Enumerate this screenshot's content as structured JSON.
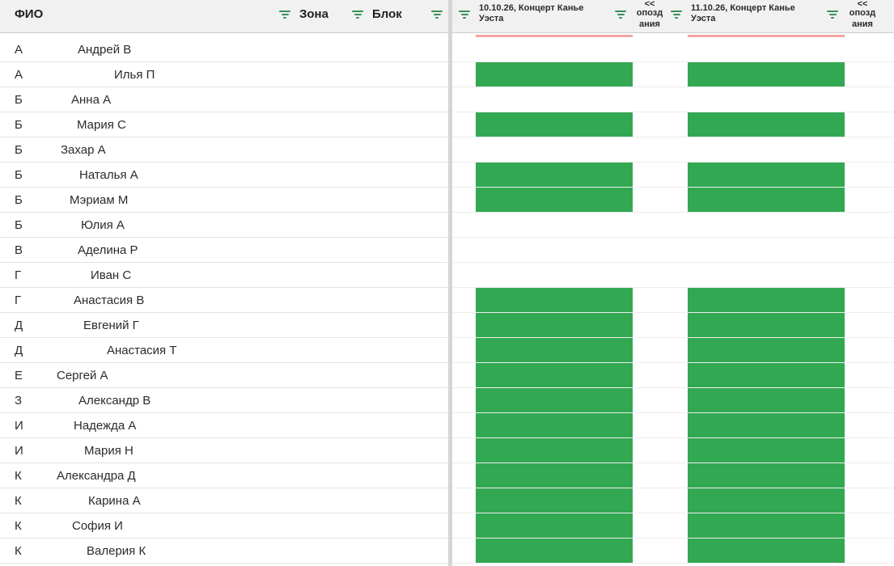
{
  "header": {
    "fio": "ФИО",
    "zona": "Зона",
    "blok": "Блок",
    "event1_line1": "10.10.26, Концерт Канье",
    "event1_line2": "Уэста",
    "late1_line1": "<<",
    "late1_line2": "опозд",
    "late1_line3": "ания",
    "event2_line1": "11.10.26, Концерт Канье",
    "event2_line2": "Уэста",
    "late2_line1": "<<",
    "late2_line2": "опозд",
    "late2_line3": "ания"
  },
  "colors": {
    "attended": "#33a853",
    "filter_icon": "#3a8f55",
    "header_bg": "#f1f1f1"
  },
  "rows": [
    {
      "zone": "А",
      "name": "Андрей В",
      "event1": false,
      "event2": false
    },
    {
      "zone": "А",
      "name": "Илья П",
      "event1": true,
      "event2": true
    },
    {
      "zone": "Б",
      "name": "Анна А",
      "event1": false,
      "event2": false
    },
    {
      "zone": "Б",
      "name": "Мария С",
      "event1": true,
      "event2": true
    },
    {
      "zone": "Б",
      "name": "Захар А",
      "event1": false,
      "event2": false
    },
    {
      "zone": "Б",
      "name": "Наталья А",
      "event1": true,
      "event2": true
    },
    {
      "zone": "Б",
      "name": "Мэриам М",
      "event1": true,
      "event2": true
    },
    {
      "zone": "Б",
      "name": "Юлия А",
      "event1": false,
      "event2": false
    },
    {
      "zone": "В",
      "name": "Аделина Р",
      "event1": false,
      "event2": false
    },
    {
      "zone": "Г",
      "name": "Иван С",
      "event1": false,
      "event2": false
    },
    {
      "zone": "Г",
      "name": "Анастасия В",
      "event1": true,
      "event2": true
    },
    {
      "zone": "Д",
      "name": "Евгений Г",
      "event1": true,
      "event2": true
    },
    {
      "zone": "Д",
      "name": "Анастасия Т",
      "event1": true,
      "event2": true
    },
    {
      "zone": "Е",
      "name": "Сергей А",
      "event1": true,
      "event2": true
    },
    {
      "zone": "З",
      "name": "Александр В",
      "event1": true,
      "event2": true
    },
    {
      "zone": "И",
      "name": "Надежда А",
      "event1": true,
      "event2": true
    },
    {
      "zone": "И",
      "name": "Мария Н",
      "event1": true,
      "event2": true
    },
    {
      "zone": "К",
      "name": "Александра Д",
      "event1": true,
      "event2": true
    },
    {
      "zone": "К",
      "name": "Карина А",
      "event1": true,
      "event2": true
    },
    {
      "zone": "К",
      "name": "София И",
      "event1": true,
      "event2": true
    },
    {
      "zone": "К",
      "name": "Валерия К",
      "event1": true,
      "event2": true
    }
  ]
}
